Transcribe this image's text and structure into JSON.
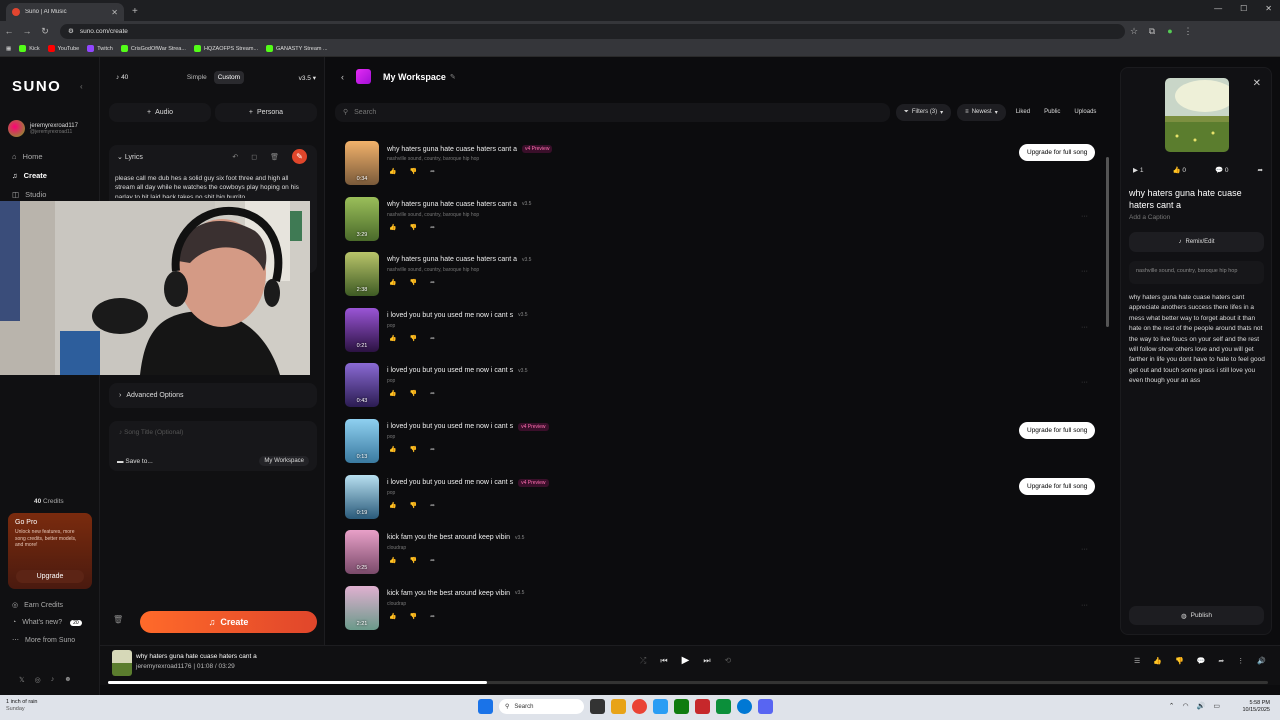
{
  "browser": {
    "tab_title": "Suno | AI Music",
    "url": "suno.com/create",
    "bookmarks": [
      "Kick",
      "YouTube",
      "Twitch",
      "CrisGodOfWar Strea...",
      "HQZAOFPS Stream...",
      "GANASTY Stream ..."
    ]
  },
  "sidebar": {
    "logo": "SUNO",
    "user_name": "jeremyrexroad117",
    "user_handle": "@jeremyrexroad11",
    "nav": [
      {
        "label": "Home",
        "icon": "home-icon"
      },
      {
        "label": "Create",
        "icon": "music-note-icon"
      },
      {
        "label": "Studio",
        "icon": "studio-icon"
      }
    ],
    "credits_num": "40",
    "credits_label": "Credits",
    "gopro": {
      "title": "Go Pro",
      "desc": "Unlock new features, more song credits, better models, and more!",
      "button": "Upgrade"
    },
    "bottom_nav": [
      {
        "label": "Earn Credits"
      },
      {
        "label": "What's new?",
        "badge": "20"
      },
      {
        "label": "More from Suno"
      }
    ]
  },
  "create": {
    "credits": "40",
    "mode_simple": "Simple",
    "mode_custom": "Custom",
    "version": "v3.5",
    "audio_btn": "Audio",
    "persona_btn": "Persona",
    "lyrics_label": "Lyrics",
    "lyrics_text": "please call me dub hes a solid guy six foot three and high all stream all day while he watches the cowboys play hoping on his parlay to hit laid back takes no shit big burrito",
    "advanced_label": "Advanced Options",
    "song_title_placeholder": "Song Title (Optional)",
    "save_to": "Save to...",
    "workspace": "My Workspace",
    "create_btn": "Create"
  },
  "workspace": {
    "title": "My Workspace",
    "search_placeholder": "Search",
    "filters": "Filters (3)",
    "sort": "Newest",
    "liked": "Liked",
    "public": "Public",
    "uploads": "Uploads",
    "upgrade_label": "Upgrade for full song",
    "songs": [
      {
        "title": "why haters guna hate cuase haters cant a",
        "tag": "v4 Preview",
        "style": "nashville sound, country, baroque hip hop",
        "duration": "0:34",
        "upgrade": true
      },
      {
        "title": "why haters guna hate cuase haters cant a",
        "tag": "v3.5",
        "style": "nashville sound, country, baroque hip hop",
        "duration": "3:29",
        "upgrade": false
      },
      {
        "title": "why haters guna hate cuase haters cant a",
        "tag": "v3.5",
        "style": "nashville sound, country, baroque hip hop",
        "duration": "2:38",
        "upgrade": false
      },
      {
        "title": "i loved you but you used me now i cant s",
        "tag": "v3.5",
        "style": "pop",
        "duration": "0:21",
        "upgrade": false
      },
      {
        "title": "i loved you but you used me now i cant s",
        "tag": "v3.5",
        "style": "pop",
        "duration": "0:43",
        "upgrade": false
      },
      {
        "title": "i loved you but you used me now i cant s",
        "tag": "v4 Preview",
        "style": "pop",
        "duration": "0:13",
        "upgrade": true
      },
      {
        "title": "i loved you but you used me now i cant s",
        "tag": "v4 Preview",
        "style": "pop",
        "duration": "0:19",
        "upgrade": true
      },
      {
        "title": "kick fam you the best around keep vibin",
        "tag": "v3.5",
        "style": "cloudrap",
        "duration": "0:25",
        "upgrade": false
      },
      {
        "title": "kick fam you the best around keep vibin",
        "tag": "v3.5",
        "style": "cloudrap",
        "duration": "2:21",
        "upgrade": false
      }
    ]
  },
  "detail": {
    "plays": "1",
    "likes": "0",
    "comments": "0",
    "title": "why haters guna hate cuase haters cant a",
    "caption": "Add a Caption",
    "remix": "Remix/Edit",
    "style": "nashville sound, country, baroque hip hop",
    "lyrics": "why haters guna hate cuase haters cant appreciate anothers success there lifes in a mess what better way to forget about it than hate on the rest of the people around thats not the way to live foucs on your self and the rest will follow show others love and you will get farther in life you dont have to hate to feel good get out and touch some grass i still love you even though your an ass",
    "publish": "Publish"
  },
  "player": {
    "title": "why haters guna hate cuase haters cant a",
    "artist": "jeremyrexroad1176",
    "time": "01:08 / 03:29",
    "progress": 0.327
  },
  "taskbar": {
    "weather": "1 inch of rain",
    "weather_sub": "Sunday",
    "search": "Search",
    "time": "5:58 PM",
    "date": "10/15/2025"
  }
}
